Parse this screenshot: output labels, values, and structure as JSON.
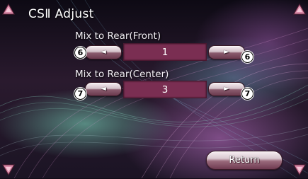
{
  "header": {
    "title": "CSⅡ Adjust"
  },
  "front": {
    "label": "Mix to Rear(Front)",
    "value": "1",
    "left_button": "◄",
    "right_button": "►",
    "left_badge": "6",
    "right_badge": "6"
  },
  "center": {
    "label": "Mix to Rear(Center)",
    "value": "3",
    "left_button": "◄",
    "right_button": "►",
    "left_badge": "7",
    "right_badge": "7"
  },
  "footer": {
    "return_label": "Return"
  },
  "colors": {
    "value_box": "#7a2e52",
    "button_top": "#f6eef2",
    "button_bottom": "#6b3a4e",
    "corner_arrow": "#d98aa8"
  },
  "icons": {
    "corner_top_left": "scroll-up-icon",
    "corner_top_right": "scroll-up-icon",
    "corner_bottom_left": "scroll-down-icon",
    "corner_bottom_right": "scroll-down-icon"
  }
}
